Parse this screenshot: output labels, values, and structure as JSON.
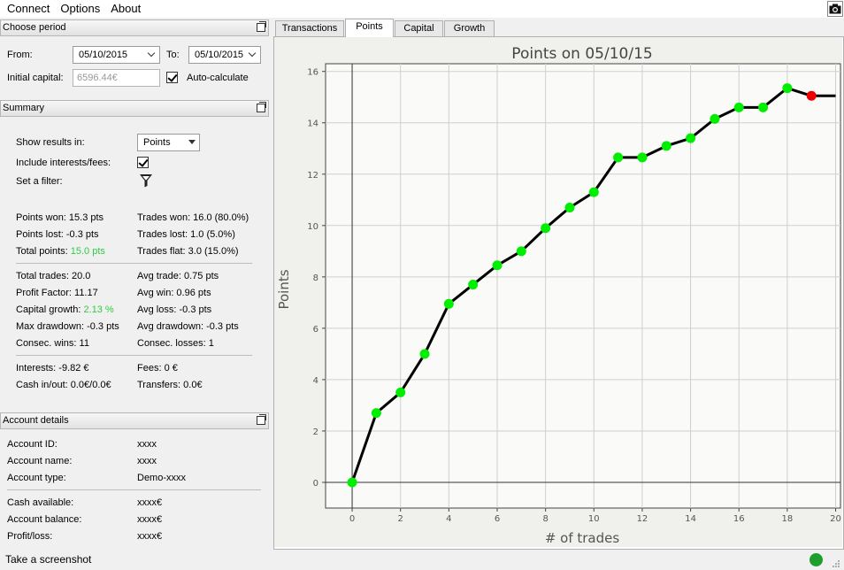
{
  "menu": {
    "items": [
      "Connect",
      "Options",
      "About"
    ]
  },
  "choose_period": {
    "title": "Choose period",
    "from_label": "From:",
    "from_value": "05/10/2015",
    "to_label": "To:",
    "to_value": "05/10/2015",
    "initial_capital_label": "Initial capital:",
    "initial_capital_placeholder": "6596.44€",
    "auto_calculate_label": "Auto-calculate",
    "auto_calculate_checked": true
  },
  "summary": {
    "title": "Summary",
    "show_results_label": "Show results in:",
    "show_results_value": "Points",
    "include_interests_label": "Include interests/fees:",
    "include_interests_checked": true,
    "set_filter_label": "Set a filter:",
    "points_won": "Points won: 15.3 pts",
    "trades_won": "Trades won: 16.0 (80.0%)",
    "points_lost": "Points lost: -0.3 pts",
    "trades_lost": "Trades lost: 1.0 (5.0%)",
    "total_points_label": "Total points: ",
    "total_points_value": "15.0 pts",
    "trades_flat": "Trades flat: 3.0 (15.0%)",
    "total_trades": "Total trades: 20.0",
    "avg_trade": "Avg trade: 0.75 pts",
    "profit_factor": "Profit Factor: 11.17",
    "avg_win": "Avg win: 0.96 pts",
    "capital_growth_label": "Capital growth: ",
    "capital_growth_value": "2.13 %",
    "avg_loss": "Avg loss: -0.3 pts",
    "max_drawdown": "Max drawdown: -0.3 pts",
    "avg_drawdown": "Avg drawdown: -0.3 pts",
    "consec_wins": "Consec. wins: 11",
    "consec_losses": "Consec. losses: 1",
    "interests": "Interests: -9.82 €",
    "fees": "Fees: 0 €",
    "cash_in_out": "Cash in/out: 0.0€/0.0€",
    "transfers": "Transfers: 0.0€"
  },
  "account": {
    "title": "Account details",
    "rows": [
      {
        "label": "Account ID:",
        "value": "xxxx"
      },
      {
        "label": "Account name:",
        "value": "xxxx"
      },
      {
        "label": "Account type:",
        "value": "Demo-xxxx"
      },
      {
        "label": "Cash available:",
        "value": "xxxx€"
      },
      {
        "label": "Account balance:",
        "value": "xxxx€"
      },
      {
        "label": "Profit/loss:",
        "value": "xxxx€"
      }
    ]
  },
  "tabs": [
    {
      "label": "Transactions",
      "active": false
    },
    {
      "label": "Points",
      "active": true
    },
    {
      "label": "Capital",
      "active": false
    },
    {
      "label": "Growth",
      "active": false
    }
  ],
  "status": {
    "text": "Take a screenshot",
    "indicator_color": "#1e9e2c"
  },
  "colors": {
    "positive": "#2ecc40",
    "point_win": "#00ee00",
    "point_loss": "#ee0000"
  },
  "chart_data": {
    "type": "line",
    "title": "Points on 05/10/15",
    "xlabel": "# of trades",
    "ylabel": "Points",
    "xlim": [
      -1.1,
      20.2
    ],
    "ylim": [
      -1,
      16.3
    ],
    "xticks": [
      0,
      2,
      4,
      6,
      8,
      10,
      12,
      14,
      16,
      18,
      20
    ],
    "yticks": [
      0,
      2,
      4,
      6,
      8,
      10,
      12,
      14,
      16
    ],
    "grid": true,
    "x": [
      0,
      1,
      2,
      3,
      4,
      5,
      6,
      7,
      8,
      9,
      10,
      11,
      12,
      13,
      14,
      15,
      16,
      17,
      18,
      19,
      20
    ],
    "y": [
      0,
      2.7,
      3.5,
      5.0,
      6.95,
      7.7,
      8.45,
      9.0,
      9.9,
      10.7,
      11.3,
      12.65,
      12.65,
      13.1,
      13.4,
      14.15,
      14.6,
      14.6,
      15.35,
      15.05,
      15.05
    ],
    "point_status": [
      "win",
      "win",
      "win",
      "win",
      "win",
      "win",
      "win",
      "win",
      "win",
      "win",
      "win",
      "win",
      "win",
      "win",
      "win",
      "win",
      "win",
      "win",
      "win",
      "loss",
      "none"
    ]
  }
}
